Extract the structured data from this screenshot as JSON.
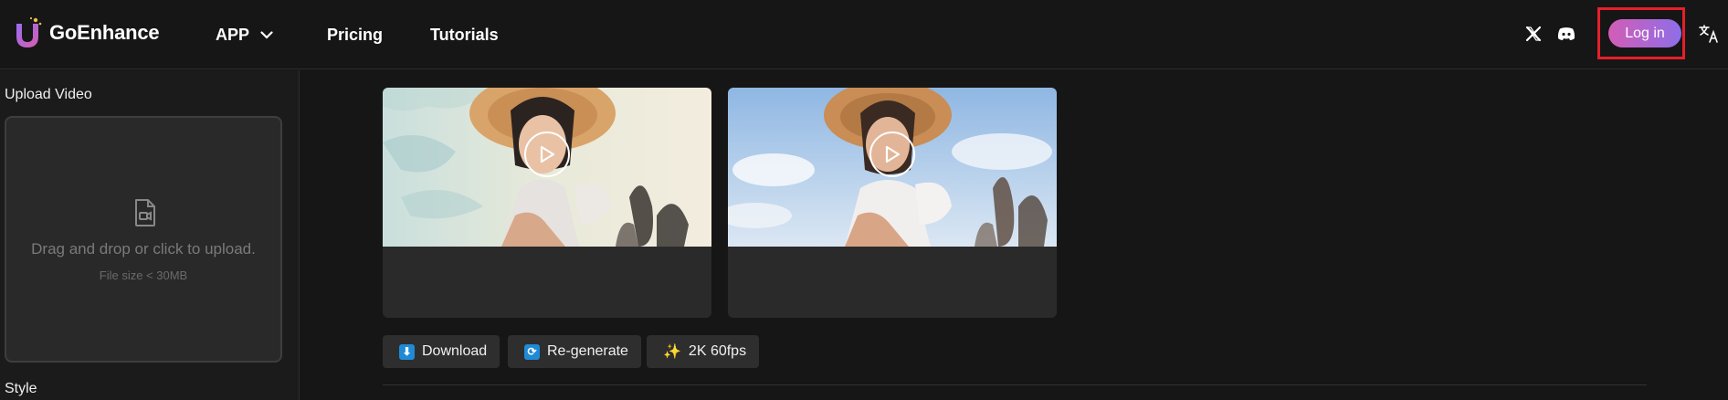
{
  "header": {
    "brand": "GoEnhance",
    "nav": {
      "app_label": "APP",
      "pricing_label": "Pricing",
      "tutorials_label": "Tutorials"
    },
    "icons": [
      "x-twitter-icon",
      "discord-icon",
      "translate-icon"
    ],
    "login_label": "Log in",
    "colors": {
      "login_gradient_start": "#d35db6",
      "login_gradient_end": "#8e6ee8",
      "highlight_frame": "#e5202a"
    }
  },
  "left_panel": {
    "upload_label": "Upload Video",
    "upload_hint": "Drag and drop or click to upload.",
    "file_size_note": "File size < 30MB",
    "style_label": "Style"
  },
  "main": {
    "videos": [
      {
        "name": "anime-style-result",
        "icon": "play-icon"
      },
      {
        "name": "original-video",
        "icon": "play-icon"
      }
    ],
    "actions": {
      "download_label": "Download",
      "regenerate_label": "Re-generate",
      "upscale_label": "2K 60fps"
    }
  }
}
